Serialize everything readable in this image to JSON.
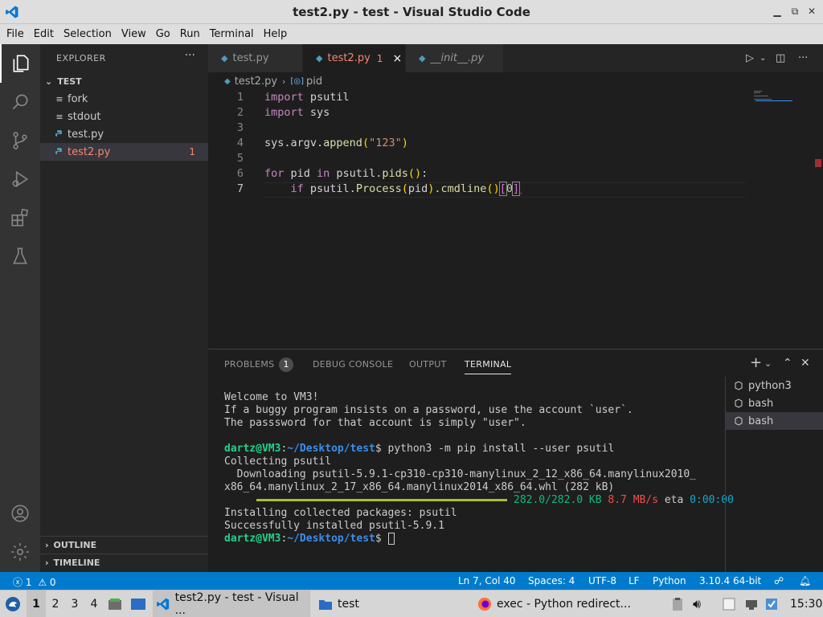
{
  "window": {
    "title": "test2.py - test - Visual Studio Code"
  },
  "menu": [
    "File",
    "Edit",
    "Selection",
    "View",
    "Go",
    "Run",
    "Terminal",
    "Help"
  ],
  "activity_bar": [
    "explorer-icon",
    "search-icon",
    "source-control-icon",
    "run-debug-icon",
    "extensions-icon",
    "testing-icon",
    "account-icon",
    "settings-gear-icon"
  ],
  "explorer": {
    "header": "EXPLORER",
    "more": "···",
    "folder": "TEST",
    "files": [
      {
        "name": "fork",
        "icon": "≡"
      },
      {
        "name": "stdout",
        "icon": "≡"
      },
      {
        "name": "test.py",
        "icon": "python"
      },
      {
        "name": "test2.py",
        "icon": "python",
        "problems": "1"
      }
    ],
    "outline": "OUTLINE",
    "timeline": "TIMELINE"
  },
  "tabs": [
    {
      "name": "test.py"
    },
    {
      "name": "test2.py",
      "problems": "1",
      "close": "×"
    },
    {
      "name": "__init__.py"
    }
  ],
  "breadcrumb": {
    "file": "test2.py",
    "symbol": "pid"
  },
  "editor": {
    "lines": [
      "1",
      "2",
      "3",
      "4",
      "5",
      "6",
      "7"
    ],
    "code": {
      "l1_kw": "import",
      "l1_mod": " psutil",
      "l2_kw": "import",
      "l2_mod": " sys",
      "l4_obj": "sys.argv.",
      "l4_fn": "append",
      "l4_open": "(",
      "l4_str": "\"123\"",
      "l4_close": ")",
      "l6_kw": "for",
      "l6_var": " pid ",
      "l6_in": "in",
      "l6_mod": " psutil.",
      "l6_fn": "pids",
      "l6_parens": "()",
      "l6_colon": ":",
      "l7_indent": "    ",
      "l7_kw": "if",
      "l7_mod": " psutil.",
      "l7_fn": "Process",
      "l7_open": "(",
      "l7_arg": "pid",
      "l7_close": ")",
      "l7_dot": ".",
      "l7_fn2": "cmdline",
      "l7_parens": "()",
      "l7_lb": "[",
      "l7_idx": "0",
      "l7_rb": "]"
    }
  },
  "panel": {
    "tabs": [
      "PROBLEMS",
      "DEBUG CONSOLE",
      "OUTPUT",
      "TERMINAL"
    ],
    "problems_count": "1",
    "terminal": {
      "welcome": "Welcome to VM3!",
      "line2": "If a buggy program insists on a password, use the account `user`.",
      "line3": "The passsword for that account is simply \"user\".",
      "prompt_user": "dartz@VM3",
      "prompt_path": "~/Desktop/test",
      "prompt_end": "$ ",
      "cmd": "python3 -m pip install --user psutil",
      "collecting": "Collecting psutil",
      "downloading1": "  Downloading psutil-5.9.1-cp310-cp310-manylinux_2_12_x86_64.manylinux2010_",
      "downloading2": "x86_64.manylinux_2_17_x86_64.manylinux2014_x86_64.whl (282 kB)",
      "progress": 1.0,
      "progress_size": "282.0/282.0 KB",
      "progress_speed": "8.7 MB/s",
      "progress_eta_label": "eta",
      "progress_eta": "0:00:00",
      "installing": "Installing collected packages: psutil",
      "success": "Successfully installed psutil-5.9.1",
      "cursor": " "
    },
    "terminal_list": [
      "python3",
      "bash",
      "bash"
    ]
  },
  "status": {
    "errors": "1",
    "warnings": "0",
    "position": "Ln 7, Col 40",
    "spaces": "Spaces: 4",
    "encoding": "UTF-8",
    "eol": "LF",
    "language": "Python",
    "interpreter": "3.10.4 64-bit"
  },
  "taskbar": {
    "workspaces": [
      "1",
      "2",
      "3",
      "4"
    ],
    "vscode_window": "test2.py - test - Visual ...",
    "folder_window": "test",
    "firefox_window": "exec - Python redirect...",
    "time": "15:30"
  },
  "colors": {
    "status_bar": "#007acc",
    "error_text": "#f48771",
    "terminal_green": "#23d18b",
    "terminal_blue": "#3b8eea"
  }
}
